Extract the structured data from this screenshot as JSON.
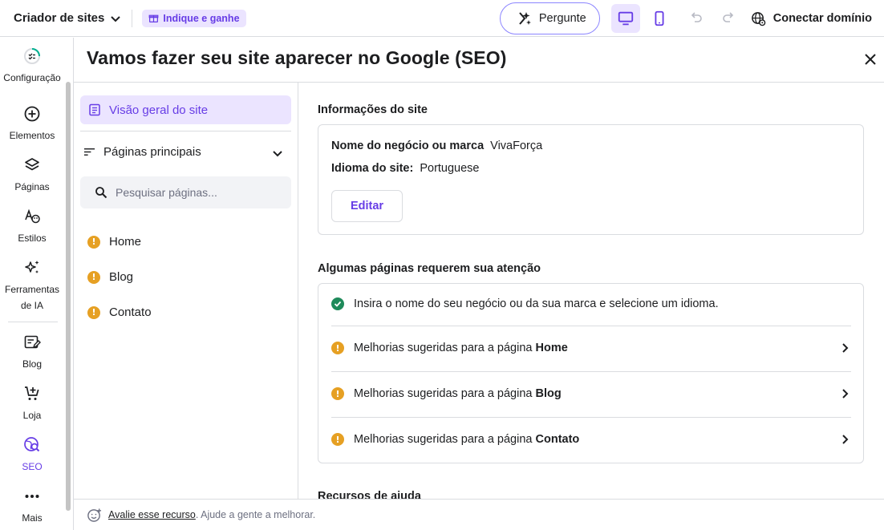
{
  "topbar": {
    "brand": "Criador de sites",
    "refer": "Indique e ganhe",
    "ask": "Pergunte",
    "connect": "Conectar domínio"
  },
  "rail": {
    "items": [
      {
        "label": "Configuração"
      },
      {
        "label": "Elementos"
      },
      {
        "label": "Páginas"
      },
      {
        "label": "Estilos"
      },
      {
        "label": "Ferramentas de IA"
      },
      {
        "label": "Blog"
      },
      {
        "label": "Loja"
      },
      {
        "label": "SEO"
      },
      {
        "label": "Mais"
      }
    ]
  },
  "panel": {
    "title": "Vamos fazer seu site aparecer no Google (SEO)"
  },
  "nav": {
    "overview": "Visão geral do site",
    "pages_label": "Páginas principais",
    "search_placeholder": "Pesquisar páginas...",
    "pages": [
      "Home",
      "Blog",
      "Contato"
    ]
  },
  "site_info": {
    "title": "Informações do site",
    "business_label": "Nome do negócio ou marca",
    "business_value": "VivaForça",
    "language_label": "Idioma do site:",
    "language_value": "Portuguese",
    "edit": "Editar"
  },
  "attention": {
    "title": "Algumas páginas requerem sua atenção",
    "done_text": "Insira o nome do seu negócio ou da sua marca e selecione um idioma.",
    "prefix": "Melhorias sugeridas para a página",
    "pages": [
      "Home",
      "Blog",
      "Contato"
    ]
  },
  "resources_title": "Recursos de ajuda",
  "footer": {
    "link": "Avalie esse recurso",
    "text": ". Ajude a gente a melhorar."
  },
  "colors": {
    "accent": "#673de6",
    "accent_light": "#ebe4ff",
    "warning": "#e6a023",
    "success": "#1e8a5a"
  }
}
